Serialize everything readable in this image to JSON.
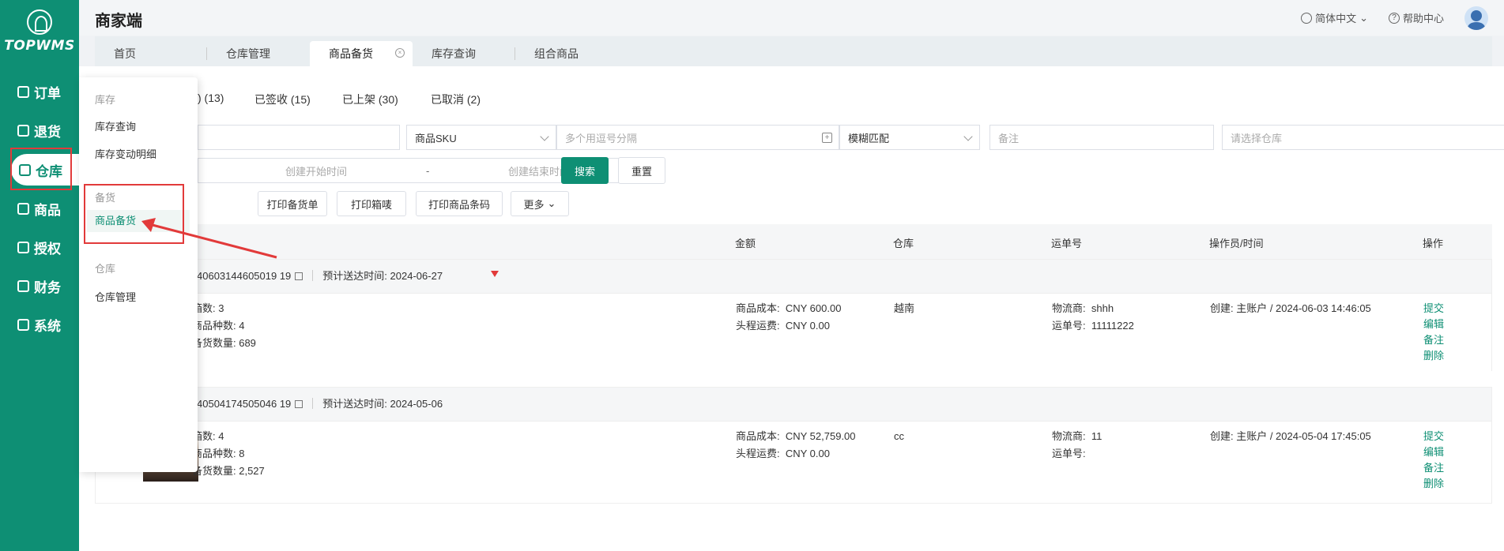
{
  "brand": {
    "logo_text": "TOPWMS"
  },
  "sidebar": {
    "items": [
      {
        "label": "订单"
      },
      {
        "label": "退货"
      },
      {
        "label": "仓库"
      },
      {
        "label": "商品"
      },
      {
        "label": "授权"
      },
      {
        "label": "财务"
      },
      {
        "label": "系统"
      }
    ]
  },
  "header": {
    "title": "商家端",
    "language": "简体中文",
    "help": "帮助中心"
  },
  "tabs": [
    {
      "label": "首页"
    },
    {
      "label": "仓库管理"
    },
    {
      "label": "商品备货"
    },
    {
      "label": "库存查询"
    },
    {
      "label": "组合商品"
    }
  ],
  "dropdown": {
    "sections": [
      {
        "title": "库存",
        "items": [
          "库存查询",
          "库存变动明细"
        ]
      },
      {
        "title": "备货",
        "items": [
          "商品备货"
        ]
      },
      {
        "title": "仓库",
        "items": [
          "仓库管理"
        ]
      }
    ]
  },
  "status_tabs": [
    {
      "label": ") (13)"
    },
    {
      "label": "已签收 (15)"
    },
    {
      "label": "已上架 (30)"
    },
    {
      "label": "已取消 (2)"
    }
  ],
  "filters": {
    "sku_select": "商品SKU",
    "sku_input_placeholder": "多个用逗号分隔",
    "match_select": "模糊匹配",
    "remark_placeholder": "备注",
    "warehouse_placeholder": "请选择仓库",
    "start_placeholder": "创建开始时间",
    "range_sep": "-",
    "end_placeholder": "创建结束时间",
    "search": "搜索",
    "reset": "重置"
  },
  "actions": {
    "print_stock_list": "打印备货单",
    "print_box_label": "打印箱唛",
    "print_barcode": "打印商品条码",
    "more": "更多"
  },
  "table": {
    "headers": [
      "金额",
      "仓库",
      "运单号",
      "操作员/时间",
      "操作"
    ],
    "orders": [
      {
        "order_no": "40603144605019 19",
        "order_no_text": "40603144605019 19",
        "eta_label": "预计送达时间:",
        "eta": "2024-06-27",
        "box_count": "箱数:  3",
        "sku_kinds": "商品种数:  4",
        "stock_qty": "备货数量:  689",
        "cost_label": "商品成本:",
        "cost": "CNY 600.00",
        "freight_label": "头程运费:",
        "freight": "CNY 0.00",
        "warehouse": "越南",
        "carrier_label": "物流商:",
        "carrier": "shhh",
        "waybill_label": "运单号:",
        "waybill": "11111222",
        "operator": "创建: 主账户 / 2024-06-03 14:46:05",
        "ops": [
          "提交",
          "编辑",
          "备注",
          "删除"
        ]
      },
      {
        "order_no_text": "40504174505046 19",
        "eta_label": "预计送达时间:",
        "eta": "2024-05-06",
        "box_count": "箱数:  4",
        "sku_kinds": "商品种数:  8",
        "stock_qty": "备货数量:  2,527",
        "cost_label": "商品成本:",
        "cost": "CNY 52,759.00",
        "freight_label": "头程运费:",
        "freight": "CNY 0.00",
        "warehouse": "cc",
        "carrier_label": "物流商:",
        "carrier": "11",
        "waybill_label": "运单号:",
        "waybill": "",
        "operator": "创建: 主账户 / 2024-05-04 17:45:05",
        "ops": [
          "提交",
          "编辑",
          "备注",
          "删除"
        ]
      }
    ]
  },
  "colors": {
    "brand": "#0e8f74",
    "annotation": "#e23a3a"
  }
}
